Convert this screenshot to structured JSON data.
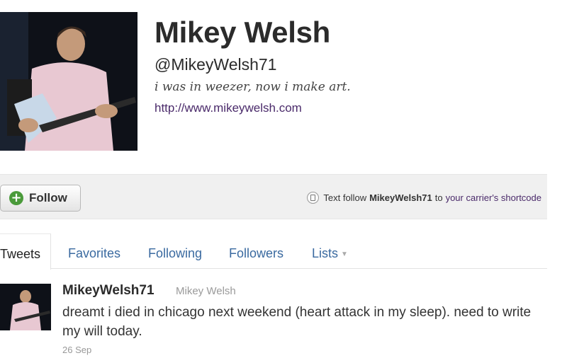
{
  "profile": {
    "name": "Mikey Welsh",
    "handle": "@MikeyWelsh71",
    "bio": "i was in weezer, now i make art.",
    "url": "http://www.mikeywelsh.com"
  },
  "actions": {
    "follow_label": "Follow",
    "sms_prefix": "Text follow",
    "sms_keyword": "MikeyWelsh71",
    "sms_to": "to",
    "sms_link": "your carrier's shortcode"
  },
  "tabs": [
    {
      "label": "Tweets"
    },
    {
      "label": "Favorites"
    },
    {
      "label": "Following"
    },
    {
      "label": "Followers"
    },
    {
      "label": "Lists"
    }
  ],
  "tweet": {
    "username": "MikeyWelsh71",
    "fullname": "Mikey Welsh",
    "text": "dreamt i died in chicago next weekend (heart attack in my sleep). need to write my will today.",
    "date": "26 Sep"
  },
  "colors": {
    "link": "#4a2a6a",
    "tab_link": "#3a6aa0",
    "follow_icon": "#4a9a3a"
  }
}
